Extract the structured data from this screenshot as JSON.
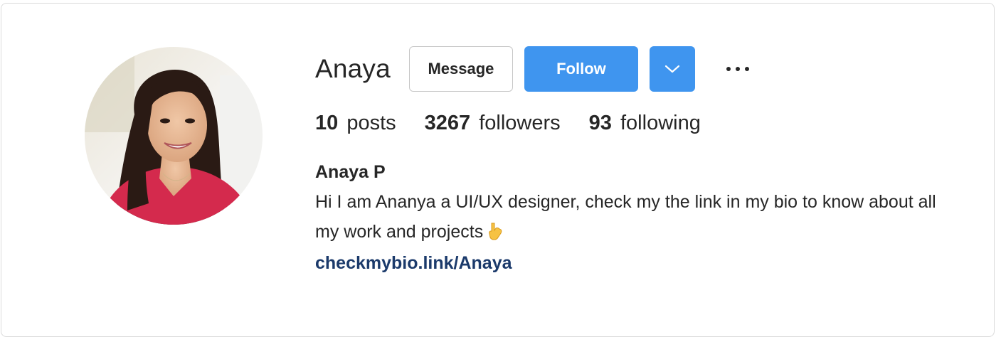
{
  "profile": {
    "username": "Anaya",
    "full_name": "Anaya P",
    "bio_text": "Hi I am Ananya a UI/UX designer, check my the link in my bio to know about all my work and projects",
    "bio_emoji_icon": "pointing-down-hand-icon",
    "link": "checkmybio.link/Anaya",
    "avatar_icon": "profile-photo"
  },
  "actions": {
    "message_label": "Message",
    "follow_label": "Follow",
    "dropdown_icon": "chevron-down-icon",
    "more_icon": "more-options-icon"
  },
  "stats": {
    "posts_count": "10",
    "posts_label": "posts",
    "followers_count": "3267",
    "followers_label": "followers",
    "following_count": "93",
    "following_label": "following"
  },
  "colors": {
    "accent": "#3f95ef",
    "link": "#1b3a6b",
    "text": "#262626",
    "border": "#dbdbdb"
  }
}
